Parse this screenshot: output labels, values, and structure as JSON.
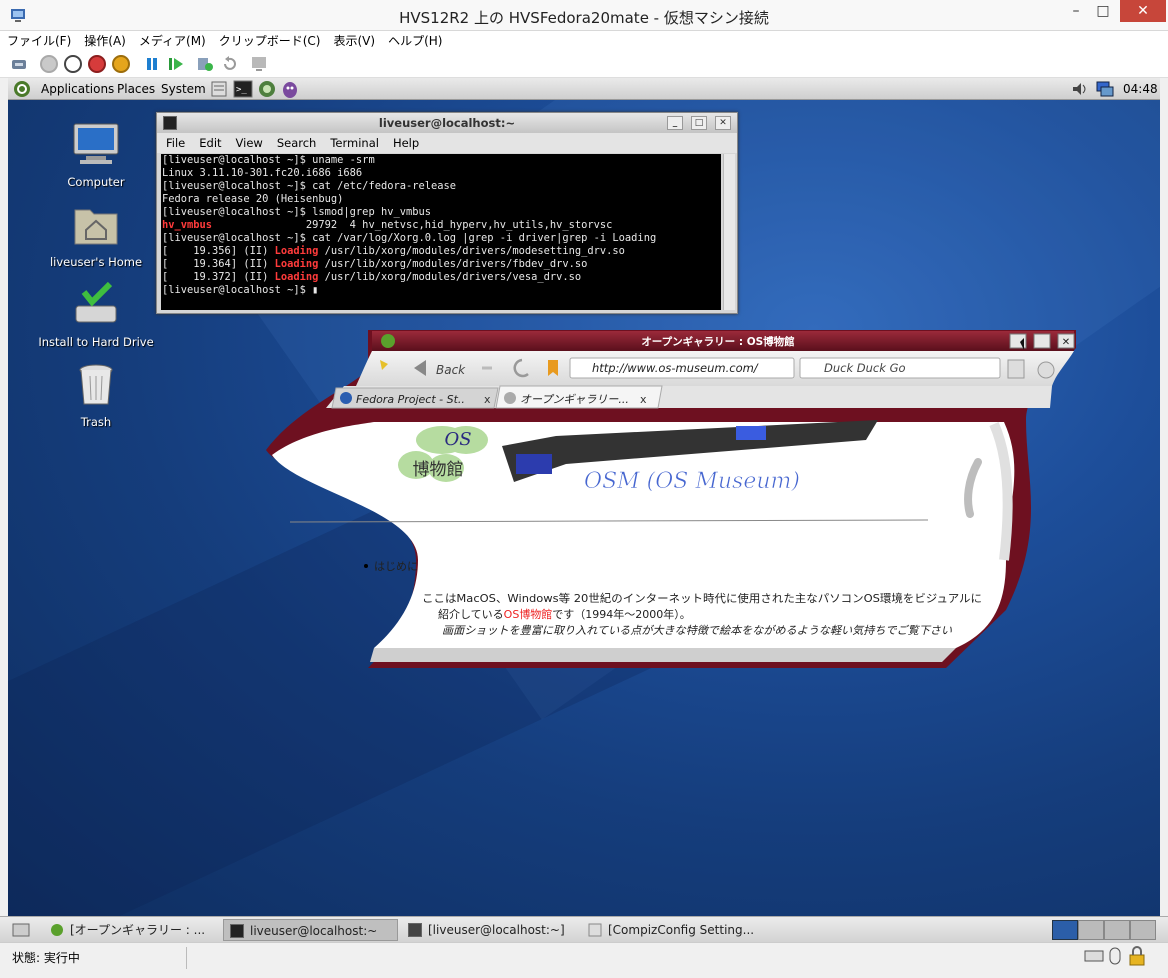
{
  "window": {
    "title": "HVS12R2 上の HVSFedora20mate  - 仮想マシン接続",
    "minimize": "–",
    "maximize": "□",
    "close": "✕"
  },
  "menu": [
    "ファイル(F)",
    "操作(A)",
    "メディア(M)",
    "クリップボード(C)",
    "表示(V)",
    "ヘルプ(H)"
  ],
  "toolbar_icons": [
    "ctrl-alt-del-icon",
    "start-icon",
    "turn-off-icon",
    "shutdown-icon",
    "save-icon",
    "pause-icon",
    "resume-icon",
    "checkpoint-icon",
    "revert-icon",
    "enhanced-session-icon"
  ],
  "guest_panel": {
    "menus": [
      "Applications",
      "Places",
      "System"
    ],
    "clock": "04:48"
  },
  "desktop_icons": [
    {
      "label": "Computer"
    },
    {
      "label": "liveuser's Home"
    },
    {
      "label": "Install to Hard Drive"
    },
    {
      "label": "Trash"
    }
  ],
  "terminal": {
    "title": "liveuser@localhost:~",
    "menu": [
      "File",
      "Edit",
      "View",
      "Search",
      "Terminal",
      "Help"
    ],
    "lines": [
      [
        {
          "t": "[liveuser@localhost ~]$ uname -srm"
        }
      ],
      [
        {
          "t": "Linux 3.11.10-301.fc20.i686 i686"
        }
      ],
      [
        {
          "t": "[liveuser@localhost ~]$ cat /etc/fedora-release"
        }
      ],
      [
        {
          "t": "Fedora release 20 (Heisenbug)"
        }
      ],
      [
        {
          "t": "[liveuser@localhost ~]$ lsmod|grep hv_vmbus"
        }
      ],
      [
        {
          "t": "hv_vmbus",
          "red": true
        },
        {
          "t": "               29792  4 hv_netvsc,hid_hyperv,hv_utils,hv_storvsc"
        }
      ],
      [
        {
          "t": "[liveuser@localhost ~]$ cat /var/log/Xorg.0.log |grep -i driver|grep -i Loading"
        }
      ],
      [
        {
          "t": "[    19.356] (II) "
        },
        {
          "t": "Loading",
          "red": true
        },
        {
          "t": " /usr/lib/xorg/modules/drivers/modesetting_drv.so"
        }
      ],
      [
        {
          "t": "[    19.364] (II) "
        },
        {
          "t": "Loading",
          "red": true
        },
        {
          "t": " /usr/lib/xorg/modules/drivers/fbdev_drv.so"
        }
      ],
      [
        {
          "t": "[    19.372] (II) "
        },
        {
          "t": "Loading",
          "red": true
        },
        {
          "t": " /usr/lib/xorg/modules/drivers/vesa_drv.so"
        }
      ],
      [
        {
          "t": "[liveuser@localhost ~]$ "
        },
        {
          "t": "▮",
          "cursor": true
        }
      ]
    ]
  },
  "browser": {
    "title": "オープンギャラリー : OS博物館",
    "back": "Back",
    "url": "http://www.os-museum.com/",
    "search": "Duck Duck Go",
    "tabs": [
      "Fedora Project - St..",
      "オープンギャラリー..."
    ],
    "tab_close": "x",
    "logo_line1": "OS",
    "logo_line2": "博物館",
    "site_title": "OSM (OS Museum)",
    "heading": "はじめに",
    "para1a": "ここはMacOS、Windows等 20世紀のインターネット時代に使用された主なパソコンOS環境をビジュアルに",
    "para1b_pre": "紹介している",
    "para1b_link": "OS博物館",
    "para1b_post": "です（1994年〜2000年）。",
    "para2": "画面ショットを豊富に取り入れている点が大きな特徴で絵本をながめるような軽い気持ちでご覧下さい"
  },
  "taskbar": {
    "items": [
      "[オープンギャラリー : ...",
      "liveuser@localhost:~",
      "[liveuser@localhost:~]",
      "[CompizConfig Setting..."
    ]
  },
  "status": {
    "text": "状態: 実行中"
  }
}
